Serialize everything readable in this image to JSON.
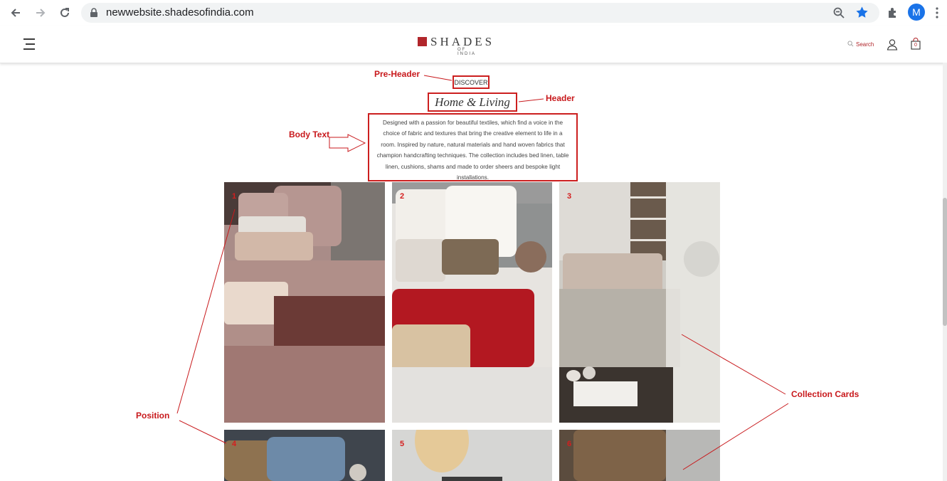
{
  "browser": {
    "url": "newwebsite.shadesofindia.com",
    "profile_initial": "M",
    "icons": [
      "back-arrow-icon",
      "forward-arrow-icon",
      "reload-icon",
      "lock-icon",
      "zoom-icon",
      "star-icon",
      "extensions-icon",
      "kebab-menu-icon"
    ]
  },
  "site": {
    "logo_word": "SHADES",
    "logo_sub": "OF INDIA",
    "search_label": "Search",
    "cart_count": "0"
  },
  "intro": {
    "pre_header": "DISCOVER",
    "header": "Home & Living",
    "body": "Designed with a passion for beautiful textiles, which find a voice in the choice of fabric and textures that bring the creative element to life in a room. Inspired by nature, natural materials and hand woven fabrics that champion handcrafting techniques. The collection includes bed linen, table linen, cushions, shams and made to order sheers and bespoke light installations."
  },
  "annotations": {
    "pre_header": "Pre-Header",
    "header": "Header",
    "body_text": "Body Text",
    "position": "Position",
    "collection_cards": "Collection Cards"
  },
  "cards": [
    {
      "position": "1"
    },
    {
      "position": "2"
    },
    {
      "position": "3"
    },
    {
      "position": "4"
    },
    {
      "position": "5"
    },
    {
      "position": "6"
    }
  ],
  "colors": {
    "brand_red": "#b1262b",
    "annotation_red": "#c8191c",
    "chrome_accent": "#1a73e8"
  }
}
